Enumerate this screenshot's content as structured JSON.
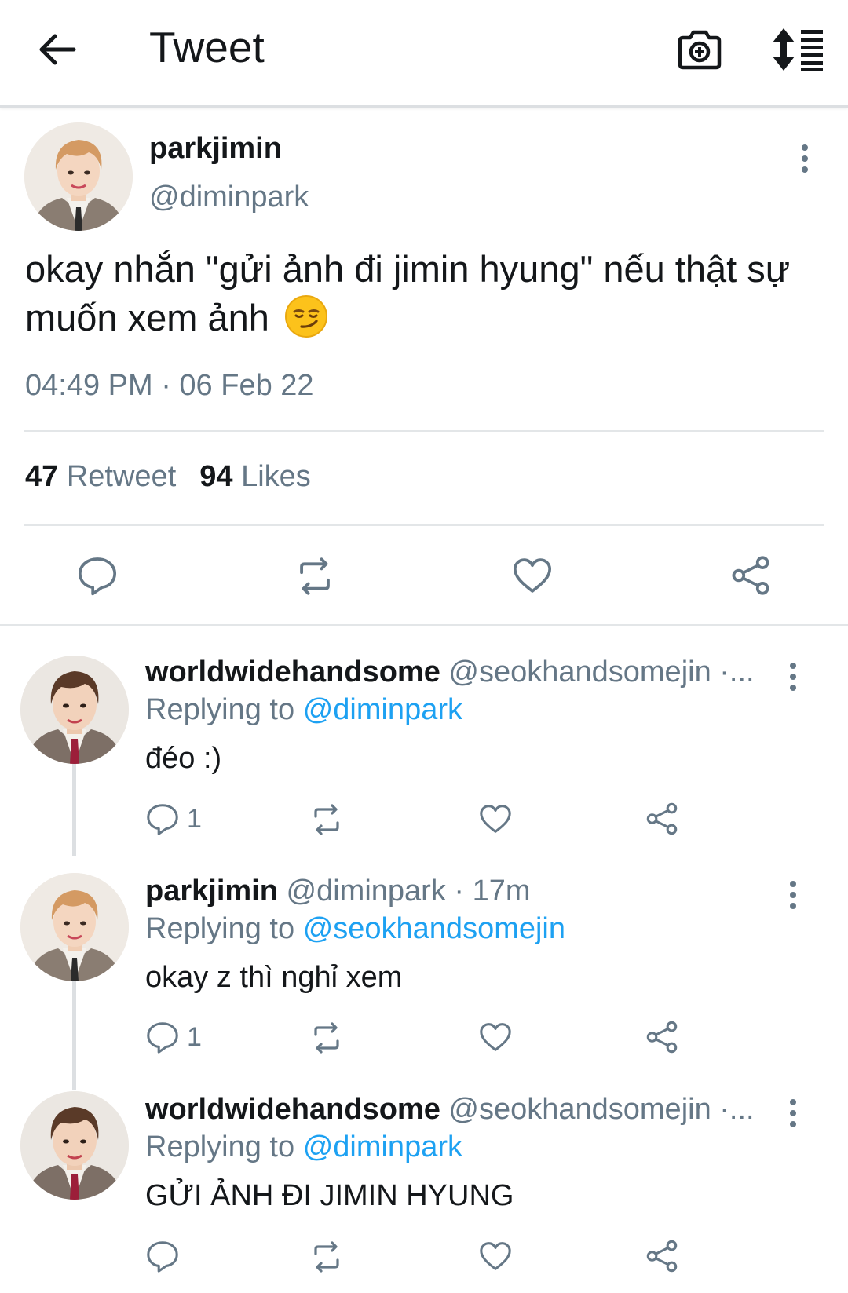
{
  "header": {
    "title": "Tweet",
    "back_icon": "arrow-left-icon",
    "camera_icon": "camera-plus-icon",
    "sort_icon": "sort-list-icon"
  },
  "tweet": {
    "display_name": "parkjimin",
    "handle": "@diminpark",
    "text": "okay nhắn \"gửi ảnh đi jimin hyung\" nếu thật sự muốn xem ảnh",
    "emoji": "smirk-emoji",
    "timestamp": "04:49 PM · 06 Feb 22",
    "retweet_count": "47",
    "retweet_label": "Retweet",
    "likes_count": "94",
    "likes_label": "Likes"
  },
  "replies": [
    {
      "display_name": "worldwidehandsome",
      "handle": "@seokhandsomejin ·...",
      "replying_label": "Replying to",
      "replying_to": "@diminpark",
      "text": "đéo :)",
      "reply_count": "1"
    },
    {
      "display_name": "parkjimin",
      "handle": "@diminpark · 17m",
      "replying_label": "Replying to",
      "replying_to": "@seokhandsomejin",
      "text": "okay z thì nghỉ xem",
      "reply_count": "1"
    },
    {
      "display_name": "worldwidehandsome",
      "handle": "@seokhandsomejin ·...",
      "replying_label": "Replying to",
      "replying_to": "@diminpark",
      "text": "GỬI ẢNH ĐI JIMIN HYUNG",
      "reply_count": ""
    }
  ],
  "colors": {
    "accent": "#1da1f2",
    "secondary_text": "#657786",
    "primary_text": "#14171a",
    "divider": "#e3e6e8"
  }
}
